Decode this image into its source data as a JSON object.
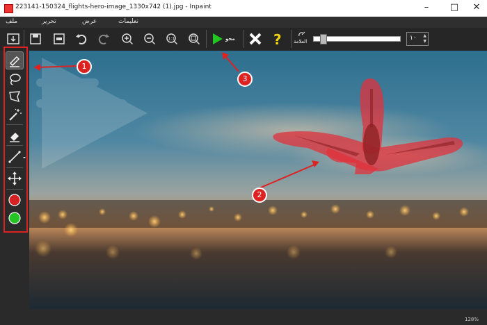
{
  "window": {
    "title": "223141-150324_flights-hero-image_1330x742 (1).jpg - Inpaint",
    "minimize_icon": "minimize-icon",
    "maximize_icon": "maximize-icon",
    "close_icon": "close-icon"
  },
  "menu": {
    "items": [
      "ملف",
      "تحرير",
      "عرض",
      "تعليمات"
    ]
  },
  "toolbar": {
    "run_label": "محو",
    "brush_label": "العلامة",
    "brush_value": "١٠",
    "brush_level": 0.08
  },
  "status": {
    "zoom": "128%"
  },
  "callouts": [
    "1",
    "2",
    "3"
  ],
  "colors": {
    "accent_red": "#dd2222",
    "run_green": "#22c522",
    "help_yellow": "#f2d10f",
    "mask_red": "#e0323c"
  }
}
